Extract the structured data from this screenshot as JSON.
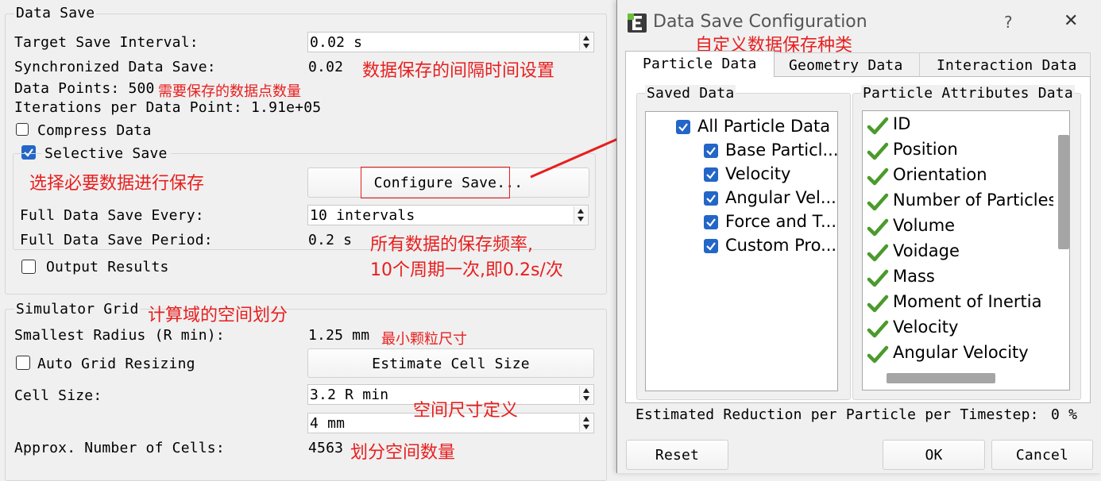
{
  "main": {
    "data_save": {
      "title": "Data Save",
      "target_interval_label": "Target Save Interval:",
      "target_interval_value": "0.02 s",
      "sync_label": "Synchronized Data Save:",
      "sync_value": "0.02",
      "data_points": "Data Points: 500",
      "iterations": "Iterations per Data Point: 1.91e+05",
      "compress_label": "Compress Data",
      "compress_checked": false,
      "selective_label": "Selective Save",
      "selective_checked": true,
      "configure_button": "Configure Save...",
      "full_every_label": "Full Data Save Every:",
      "full_every_value": "10 intervals",
      "full_period_label": "Full Data Save Period:",
      "full_period_value": "0.2 s",
      "output_label": "Output Results",
      "output_checked": false
    },
    "grid": {
      "title": "Simulator Grid",
      "smallest_label": "Smallest Radius (R min):",
      "smallest_value": "1.25 mm",
      "auto_label": "Auto Grid Resizing",
      "auto_checked": false,
      "estimate_button": "Estimate Cell Size",
      "cell_label": "Cell Size:",
      "cell_value_1": "3.2 R min",
      "cell_value_2": "4 mm",
      "approx_label": "Approx. Number of Cells:",
      "approx_value": "4563"
    }
  },
  "annotations": {
    "interval": "数据保存的间隔时间设置",
    "points": "需要保存的数据点数量",
    "select": "选择必要数据进行保存",
    "freq_line1": "所有数据的保存频率,",
    "freq_line2": "10个周期一次,即0.2s/次",
    "grid": "计算域的空间划分",
    "min_particle": "最小颗粒尺寸",
    "space_size": "空间尺寸定义",
    "cell_count": "划分空间数量",
    "dialog_title_note": "自定义数据保存种类"
  },
  "dialog": {
    "title": "Data Save Configuration",
    "help_icon_label": "?",
    "close_icon_label": "✕",
    "tabs": [
      "Particle Data",
      "Geometry Data",
      "Interaction Data"
    ],
    "active_tab": 0,
    "saved_data_title": "Saved Data",
    "saved_items": [
      {
        "label": "All Particle Data",
        "checked": true
      },
      {
        "label": "Base Particl...",
        "checked": true
      },
      {
        "label": "Velocity",
        "checked": true
      },
      {
        "label": "Angular Vel...",
        "checked": true
      },
      {
        "label": "Force and T...",
        "checked": true
      },
      {
        "label": "Custom Pro...",
        "checked": true
      }
    ],
    "attributes_title": "Particle Attributes Data",
    "attributes": [
      "ID",
      "Position",
      "Orientation",
      "Number of Particles",
      "Volume",
      "Voidage",
      "Mass",
      "Moment of Inertia",
      "Velocity",
      "Angular Velocity"
    ],
    "estimated_label": "Estimated Reduction per Particle per Timestep:",
    "estimated_value": "0 %",
    "reset_button": "Reset",
    "ok_button": "OK",
    "cancel_button": "Cancel"
  },
  "colors": {
    "annotation_red": "#e81e1e",
    "checkbox_blue": "#2366c7",
    "tick_green": "#4a9a2c"
  }
}
